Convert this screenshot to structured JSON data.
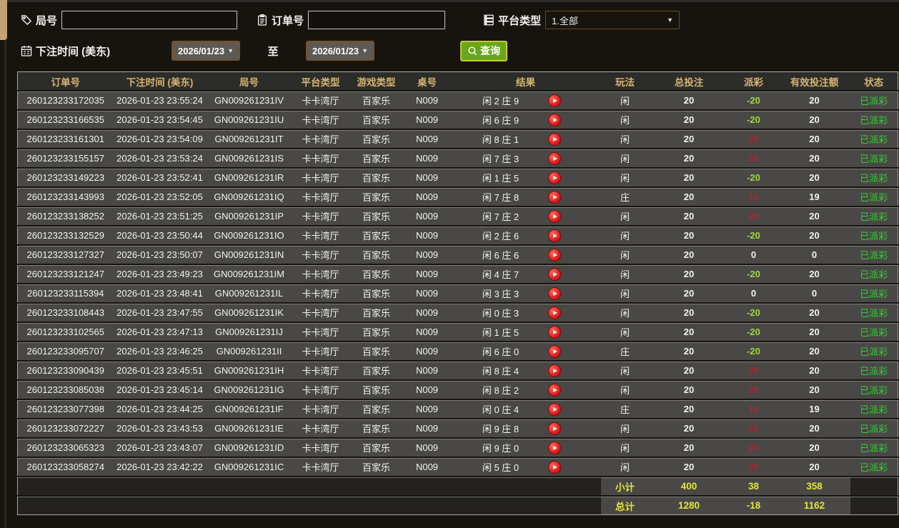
{
  "filters": {
    "round": {
      "label": "局号",
      "value": "",
      "icon": "tag-icon"
    },
    "order": {
      "label": "订单号",
      "value": "",
      "icon": "clipboard-icon"
    },
    "platform": {
      "label": "平台类型",
      "value": "1.全部",
      "icon": "list-icon"
    },
    "bet_time": {
      "label": "下注时间 (美东)",
      "icon": "calendar-icon",
      "from": "2026/01/23",
      "to_label": "至",
      "to": "2026/01/23"
    },
    "query": {
      "label": "查询",
      "icon": "search-icon"
    }
  },
  "table": {
    "columns": [
      "订单号",
      "下注时间 (美东)",
      "局号",
      "平台类型",
      "游戏类型",
      "桌号",
      "结果",
      "玩法",
      "总投注",
      "派彩",
      "有效投注额",
      "状态"
    ],
    "rows": [
      {
        "order_id": "260123233172035",
        "bet_time": "2026-01-23 23:55:24",
        "round_id": "GN009261231IV",
        "platform": "卡卡湾厅",
        "game_type": "百家乐",
        "table_no": "N009",
        "result": "闲 2 庄 9",
        "play_type": "闲",
        "total_bet": "20",
        "payout": "-20",
        "payout_sign": "neg",
        "valid_bet": "20",
        "status": "已派彩"
      },
      {
        "order_id": "260123233166535",
        "bet_time": "2026-01-23 23:54:45",
        "round_id": "GN009261231IU",
        "platform": "卡卡湾厅",
        "game_type": "百家乐",
        "table_no": "N009",
        "result": "闲 6 庄 9",
        "play_type": "闲",
        "total_bet": "20",
        "payout": "-20",
        "payout_sign": "neg",
        "valid_bet": "20",
        "status": "已派彩"
      },
      {
        "order_id": "260123233161301",
        "bet_time": "2026-01-23 23:54:09",
        "round_id": "GN009261231IT",
        "platform": "卡卡湾厅",
        "game_type": "百家乐",
        "table_no": "N009",
        "result": "闲 8 庄 1",
        "play_type": "闲",
        "total_bet": "20",
        "payout": "20",
        "payout_sign": "pos",
        "valid_bet": "20",
        "status": "已派彩"
      },
      {
        "order_id": "260123233155157",
        "bet_time": "2026-01-23 23:53:24",
        "round_id": "GN009261231IS",
        "platform": "卡卡湾厅",
        "game_type": "百家乐",
        "table_no": "N009",
        "result": "闲 7 庄 3",
        "play_type": "闲",
        "total_bet": "20",
        "payout": "20",
        "payout_sign": "pos",
        "valid_bet": "20",
        "status": "已派彩"
      },
      {
        "order_id": "260123233149223",
        "bet_time": "2026-01-23 23:52:41",
        "round_id": "GN009261231IR",
        "platform": "卡卡湾厅",
        "game_type": "百家乐",
        "table_no": "N009",
        "result": "闲 1 庄 5",
        "play_type": "闲",
        "total_bet": "20",
        "payout": "-20",
        "payout_sign": "neg",
        "valid_bet": "20",
        "status": "已派彩"
      },
      {
        "order_id": "260123233143993",
        "bet_time": "2026-01-23 23:52:05",
        "round_id": "GN009261231IQ",
        "platform": "卡卡湾厅",
        "game_type": "百家乐",
        "table_no": "N009",
        "result": "闲 7 庄 8",
        "play_type": "庄",
        "total_bet": "20",
        "payout": "19",
        "payout_sign": "pos",
        "valid_bet": "19",
        "status": "已派彩"
      },
      {
        "order_id": "260123233138252",
        "bet_time": "2026-01-23 23:51:25",
        "round_id": "GN009261231IP",
        "platform": "卡卡湾厅",
        "game_type": "百家乐",
        "table_no": "N009",
        "result": "闲 7 庄 2",
        "play_type": "闲",
        "total_bet": "20",
        "payout": "20",
        "payout_sign": "pos",
        "valid_bet": "20",
        "status": "已派彩"
      },
      {
        "order_id": "260123233132529",
        "bet_time": "2026-01-23 23:50:44",
        "round_id": "GN009261231IO",
        "platform": "卡卡湾厅",
        "game_type": "百家乐",
        "table_no": "N009",
        "result": "闲 2 庄 6",
        "play_type": "闲",
        "total_bet": "20",
        "payout": "-20",
        "payout_sign": "neg",
        "valid_bet": "20",
        "status": "已派彩"
      },
      {
        "order_id": "260123233127327",
        "bet_time": "2026-01-23 23:50:07",
        "round_id": "GN009261231IN",
        "platform": "卡卡湾厅",
        "game_type": "百家乐",
        "table_no": "N009",
        "result": "闲 6 庄 6",
        "play_type": "闲",
        "total_bet": "20",
        "payout": "0",
        "payout_sign": "zero",
        "valid_bet": "0",
        "status": "已派彩"
      },
      {
        "order_id": "260123233121247",
        "bet_time": "2026-01-23 23:49:23",
        "round_id": "GN009261231IM",
        "platform": "卡卡湾厅",
        "game_type": "百家乐",
        "table_no": "N009",
        "result": "闲 4 庄 7",
        "play_type": "闲",
        "total_bet": "20",
        "payout": "-20",
        "payout_sign": "neg",
        "valid_bet": "20",
        "status": "已派彩"
      },
      {
        "order_id": "260123233115394",
        "bet_time": "2026-01-23 23:48:41",
        "round_id": "GN009261231IL",
        "platform": "卡卡湾厅",
        "game_type": "百家乐",
        "table_no": "N009",
        "result": "闲 3 庄 3",
        "play_type": "闲",
        "total_bet": "20",
        "payout": "0",
        "payout_sign": "zero",
        "valid_bet": "0",
        "status": "已派彩"
      },
      {
        "order_id": "260123233108443",
        "bet_time": "2026-01-23 23:47:55",
        "round_id": "GN009261231IK",
        "platform": "卡卡湾厅",
        "game_type": "百家乐",
        "table_no": "N009",
        "result": "闲 0 庄 3",
        "play_type": "闲",
        "total_bet": "20",
        "payout": "-20",
        "payout_sign": "neg",
        "valid_bet": "20",
        "status": "已派彩"
      },
      {
        "order_id": "260123233102565",
        "bet_time": "2026-01-23 23:47:13",
        "round_id": "GN009261231IJ",
        "platform": "卡卡湾厅",
        "game_type": "百家乐",
        "table_no": "N009",
        "result": "闲 1 庄 5",
        "play_type": "闲",
        "total_bet": "20",
        "payout": "-20",
        "payout_sign": "neg",
        "valid_bet": "20",
        "status": "已派彩"
      },
      {
        "order_id": "260123233095707",
        "bet_time": "2026-01-23 23:46:25",
        "round_id": "GN009261231II",
        "platform": "卡卡湾厅",
        "game_type": "百家乐",
        "table_no": "N009",
        "result": "闲 6 庄 0",
        "play_type": "庄",
        "total_bet": "20",
        "payout": "-20",
        "payout_sign": "neg",
        "valid_bet": "20",
        "status": "已派彩"
      },
      {
        "order_id": "260123233090439",
        "bet_time": "2026-01-23 23:45:51",
        "round_id": "GN009261231IH",
        "platform": "卡卡湾厅",
        "game_type": "百家乐",
        "table_no": "N009",
        "result": "闲 8 庄 4",
        "play_type": "闲",
        "total_bet": "20",
        "payout": "20",
        "payout_sign": "pos",
        "valid_bet": "20",
        "status": "已派彩"
      },
      {
        "order_id": "260123233085038",
        "bet_time": "2026-01-23 23:45:14",
        "round_id": "GN009261231IG",
        "platform": "卡卡湾厅",
        "game_type": "百家乐",
        "table_no": "N009",
        "result": "闲 8 庄 2",
        "play_type": "闲",
        "total_bet": "20",
        "payout": "20",
        "payout_sign": "pos",
        "valid_bet": "20",
        "status": "已派彩"
      },
      {
        "order_id": "260123233077398",
        "bet_time": "2026-01-23 23:44:25",
        "round_id": "GN009261231IF",
        "platform": "卡卡湾厅",
        "game_type": "百家乐",
        "table_no": "N009",
        "result": "闲 0 庄 4",
        "play_type": "庄",
        "total_bet": "20",
        "payout": "19",
        "payout_sign": "pos",
        "valid_bet": "19",
        "status": "已派彩"
      },
      {
        "order_id": "260123233072227",
        "bet_time": "2026-01-23 23:43:53",
        "round_id": "GN009261231IE",
        "platform": "卡卡湾厅",
        "game_type": "百家乐",
        "table_no": "N009",
        "result": "闲 9 庄 8",
        "play_type": "闲",
        "total_bet": "20",
        "payout": "20",
        "payout_sign": "pos",
        "valid_bet": "20",
        "status": "已派彩"
      },
      {
        "order_id": "260123233065323",
        "bet_time": "2026-01-23 23:43:07",
        "round_id": "GN009261231ID",
        "platform": "卡卡湾厅",
        "game_type": "百家乐",
        "table_no": "N009",
        "result": "闲 9 庄 0",
        "play_type": "闲",
        "total_bet": "20",
        "payout": "20",
        "payout_sign": "pos",
        "valid_bet": "20",
        "status": "已派彩"
      },
      {
        "order_id": "260123233058274",
        "bet_time": "2026-01-23 23:42:22",
        "round_id": "GN009261231IC",
        "platform": "卡卡湾厅",
        "game_type": "百家乐",
        "table_no": "N009",
        "result": "闲 5 庄 0",
        "play_type": "闲",
        "total_bet": "20",
        "payout": "20",
        "payout_sign": "pos",
        "valid_bet": "20",
        "status": "已派彩"
      }
    ],
    "subtotal": {
      "label": "小计",
      "total_bet": "400",
      "payout": "38",
      "valid_bet": "358"
    },
    "grand_total": {
      "label": "总计",
      "total_bet": "1280",
      "payout": "-18",
      "valid_bet": "1162"
    }
  },
  "colors": {
    "header_gold": "#d6b470",
    "win_red": "#a62837",
    "lose_green": "#9edb35",
    "paid_green": "#2fd32f",
    "totals_yellow": "#e4e436",
    "query_green": "#69a61b",
    "row_gray": "#494846"
  }
}
